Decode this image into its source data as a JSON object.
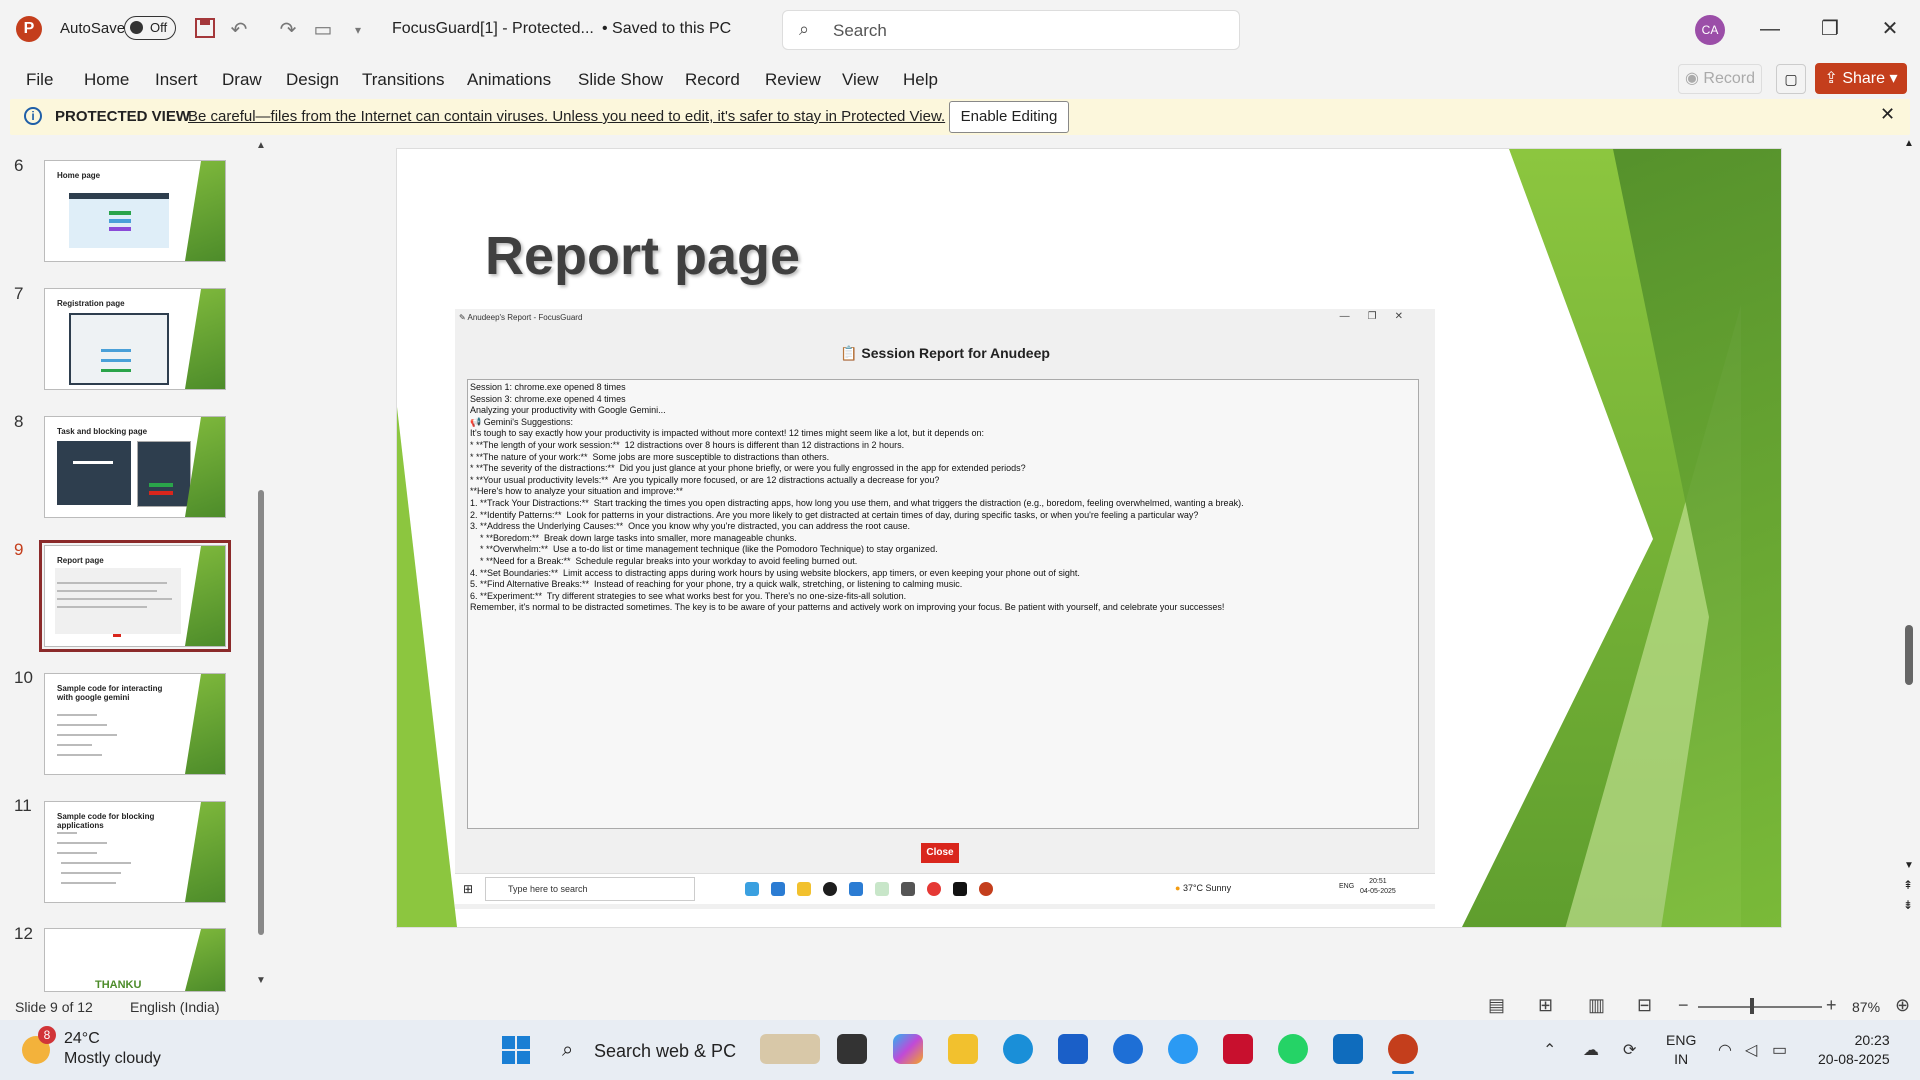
{
  "titlebar": {
    "app_letter": "P",
    "autosave_label": "AutoSave",
    "autosave_state": "Off",
    "doc_title": "FocusGuard[1]  -  Protected...",
    "saved_status": "•  Saved to this PC",
    "search_placeholder": "Search",
    "avatar_initials": "CA"
  },
  "ribbon": {
    "tabs": [
      "File",
      "Home",
      "Insert",
      "Draw",
      "Design",
      "Transitions",
      "Animations",
      "Slide Show",
      "Record",
      "Review",
      "View",
      "Help"
    ],
    "record_label": "Record",
    "share_label": "Share"
  },
  "protected_view": {
    "title": "PROTECTED VIEW",
    "message": "Be careful—files from the Internet can contain viruses. Unless you need to edit, it's safer to stay in Protected View.",
    "enable_button": "Enable Editing"
  },
  "thumbnails": [
    {
      "num": "6",
      "title": "Home page"
    },
    {
      "num": "7",
      "title": "Registration page"
    },
    {
      "num": "8",
      "title": "Task and blocking page"
    },
    {
      "num": "9",
      "title": "Report page"
    },
    {
      "num": "10",
      "title": "Sample code for interacting with google gemini"
    },
    {
      "num": "11",
      "title": "Sample code for blocking applications"
    },
    {
      "num": "12",
      "title": "THANKU"
    }
  ],
  "slide": {
    "title": "Report page",
    "inner_window_title": "Anudeep's Report - FocusGuard",
    "session_title": "Session Report for Anudeep",
    "report_lines": [
      "Session 1: chrome.exe opened 8 times",
      "",
      "Session 3: chrome.exe opened 4 times",
      "",
      "",
      "Analyzing your productivity with Google Gemini...",
      "",
      "Gemini's Suggestions:",
      "It's tough to say exactly how your productivity is impacted without more context! 12 times might seem like a lot, but it depends on:",
      "",
      "* **The length of your work session:**  12 distractions over 8 hours is different than 12 distractions in 2 hours.",
      "* **The nature of your work:**  Some jobs are more susceptible to distractions than others.",
      "* **The severity of the distractions:**  Did you just glance at your phone briefly, or were you fully engrossed in the app for extended periods?",
      "* **Your usual productivity levels:**  Are you typically more focused, or are 12 distractions actually a decrease for you?",
      "",
      "**Here's how to analyze your situation and improve:**",
      "",
      "1. **Track Your Distractions:**  Start tracking the times you open distracting apps, how long you use them, and what triggers the distraction (e.g., boredom, feeling overwhelmed, wanting a break).",
      "2. **Identify Patterns:**  Look for patterns in your distractions. Are you more likely to get distracted at certain times of day, during specific tasks, or when you're feeling a particular way?",
      "3. **Address the Underlying Causes:**  Once you know why you're distracted, you can address the root cause.",
      "    * **Boredom:**  Break down large tasks into smaller, more manageable chunks.",
      "    * **Overwhelm:**  Use a to-do list or time management technique (like the Pomodoro Technique) to stay organized.",
      "    * **Need for a Break:**  Schedule regular breaks into your workday to avoid feeling burned out.",
      "4. **Set Boundaries:**  Limit access to distracting apps during work hours by using website blockers, app timers, or even keeping your phone out of sight.",
      "5. **Find Alternative Breaks:**  Instead of reaching for your phone, try a quick walk, stretching, or listening to calming music.",
      "6. **Experiment:**  Try different strategies to see what works best for you. There's no one-size-fits-all solution.",
      "",
      "Remember, it's normal to be distracted sometimes. The key is to be aware of your patterns and actively work on improving your focus. Be patient with yourself, and celebrate your successes!"
    ],
    "close_label": "Close",
    "inner_taskbar": {
      "search_placeholder": "Type here to search",
      "weather": "37°C  Sunny",
      "lang": "ENG",
      "time": "20:51",
      "date": "04-05-2025"
    }
  },
  "statusbar": {
    "slide_info": "Slide 9 of 12",
    "language": "English (India)",
    "zoom": "87%"
  },
  "win_taskbar": {
    "weather_badge": "8",
    "temperature": "24°C",
    "condition": "Mostly cloudy",
    "search_placeholder": "Search web & PC",
    "lang_1": "ENG",
    "lang_2": "IN",
    "time": "20:23",
    "date": "20-08-2025"
  },
  "colors": {
    "accent": "#c43e1c",
    "slide_green": "#7fb93c",
    "selected_thumb": "#8b2a2a",
    "protected_bar": "#fcf7dc"
  }
}
